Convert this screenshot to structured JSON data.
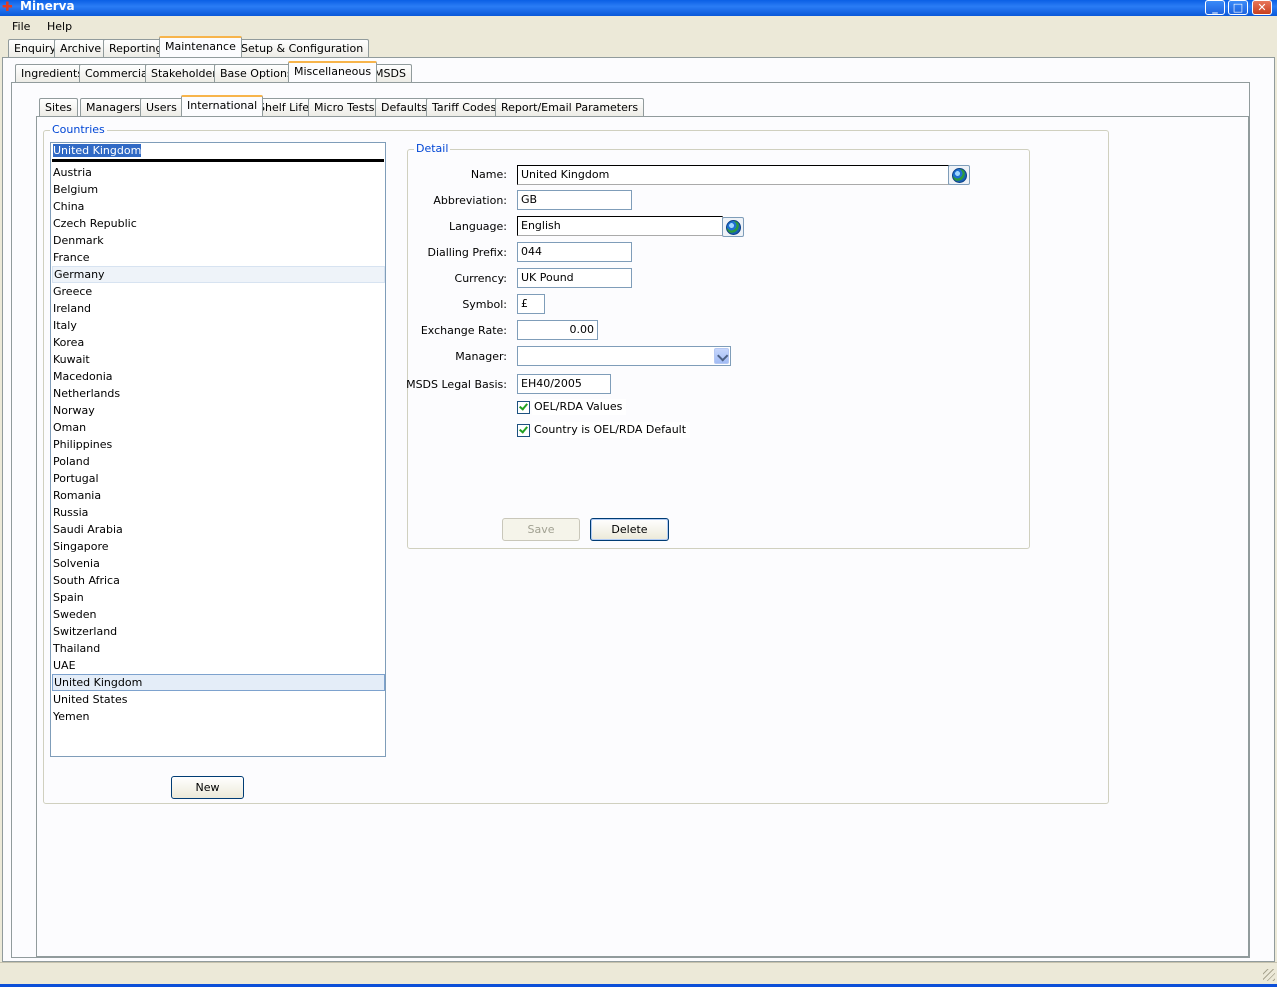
{
  "window": {
    "title": "Minerva"
  },
  "menu": [
    "File",
    "Help"
  ],
  "main_tabs": [
    "Enquiry",
    "Archive",
    "Reporting",
    "Maintenance",
    "Setup & Configuration"
  ],
  "maintenance_tabs": [
    "Ingredients",
    "Commercial",
    "Stakeholder",
    "Base Options",
    "Miscellaneous",
    "MSDS"
  ],
  "misc_tabs": [
    "Sites",
    "Managers",
    "Users",
    "International",
    "Shelf Life",
    "Micro Tests",
    "Defaults",
    "Tariff Codes",
    "Report/Email Parameters"
  ],
  "countries": {
    "group_label": "Countries",
    "search_value": "United Kingdom",
    "items": [
      "Austria",
      "Belgium",
      "China",
      "Czech Republic",
      "Denmark",
      "France",
      "Germany",
      "Greece",
      "Ireland",
      "Italy",
      "Korea",
      "Kuwait",
      "Macedonia",
      "Netherlands",
      "Norway",
      "Oman",
      "Philippines",
      "Poland",
      "Portugal",
      "Romania",
      "Russia",
      "Saudi Arabia",
      "Singapore",
      "Solvenia",
      "South Africa",
      "Spain",
      "Sweden",
      "Switzerland",
      "Thailand",
      "UAE",
      "United Kingdom",
      "United States",
      "Yemen"
    ],
    "selected": "United Kingdom",
    "hovered": "Germany",
    "new_label": "New"
  },
  "detail": {
    "group_label": "Detail",
    "name_label": "Name:",
    "name_value": "United Kingdom",
    "abbrev_label": "Abbreviation:",
    "abbrev_value": "GB",
    "language_label": "Language:",
    "language_value": "English",
    "dialling_label": "Dialling Prefix:",
    "dialling_value": "044",
    "currency_label": "Currency:",
    "currency_value": "UK Pound",
    "symbol_label": "Symbol:",
    "symbol_value": "£",
    "rate_label": "Exchange Rate:",
    "rate_value": "0.00",
    "manager_label": "Manager:",
    "manager_value": "",
    "msds_label": "MSDS Legal Basis:",
    "msds_value": "EH40/2005",
    "oel_label": "OEL/RDA Values",
    "default_label": "Country is OEL/RDA Default",
    "save_label": "Save",
    "delete_label": "Delete"
  }
}
